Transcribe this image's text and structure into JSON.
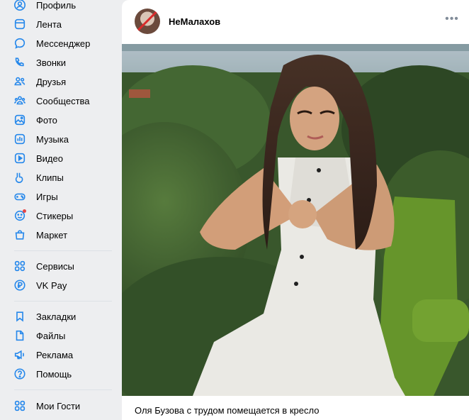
{
  "sidebar": {
    "group1": [
      {
        "label": "Профиль",
        "icon": "profile-icon"
      },
      {
        "label": "Лента",
        "icon": "feed-icon"
      },
      {
        "label": "Мессенджер",
        "icon": "messenger-icon"
      },
      {
        "label": "Звонки",
        "icon": "phone-icon"
      },
      {
        "label": "Друзья",
        "icon": "friends-icon"
      },
      {
        "label": "Сообщества",
        "icon": "communities-icon"
      },
      {
        "label": "Фото",
        "icon": "photo-icon"
      },
      {
        "label": "Музыка",
        "icon": "music-icon"
      },
      {
        "label": "Видео",
        "icon": "video-icon"
      },
      {
        "label": "Клипы",
        "icon": "clips-icon"
      },
      {
        "label": "Игры",
        "icon": "games-icon"
      },
      {
        "label": "Стикеры",
        "icon": "stickers-icon"
      },
      {
        "label": "Маркет",
        "icon": "market-icon"
      }
    ],
    "group2": [
      {
        "label": "Сервисы",
        "icon": "services-icon"
      },
      {
        "label": "VK Pay",
        "icon": "vkpay-icon"
      }
    ],
    "group3": [
      {
        "label": "Закладки",
        "icon": "bookmarks-icon"
      },
      {
        "label": "Файлы",
        "icon": "files-icon"
      },
      {
        "label": "Реклама",
        "icon": "ads-icon"
      },
      {
        "label": "Помощь",
        "icon": "help-icon"
      }
    ],
    "group4": [
      {
        "label": "Мои Гости",
        "icon": "guests-icon"
      }
    ]
  },
  "post": {
    "author": "НеМалахов",
    "more_icon": "more-horizontal-icon",
    "caption": "Оля Бузова с трудом помещается в кресло"
  },
  "colors": {
    "accent": "#2688eb",
    "background": "#edeef0",
    "card": "#ffffff",
    "notification": "#e64646"
  }
}
